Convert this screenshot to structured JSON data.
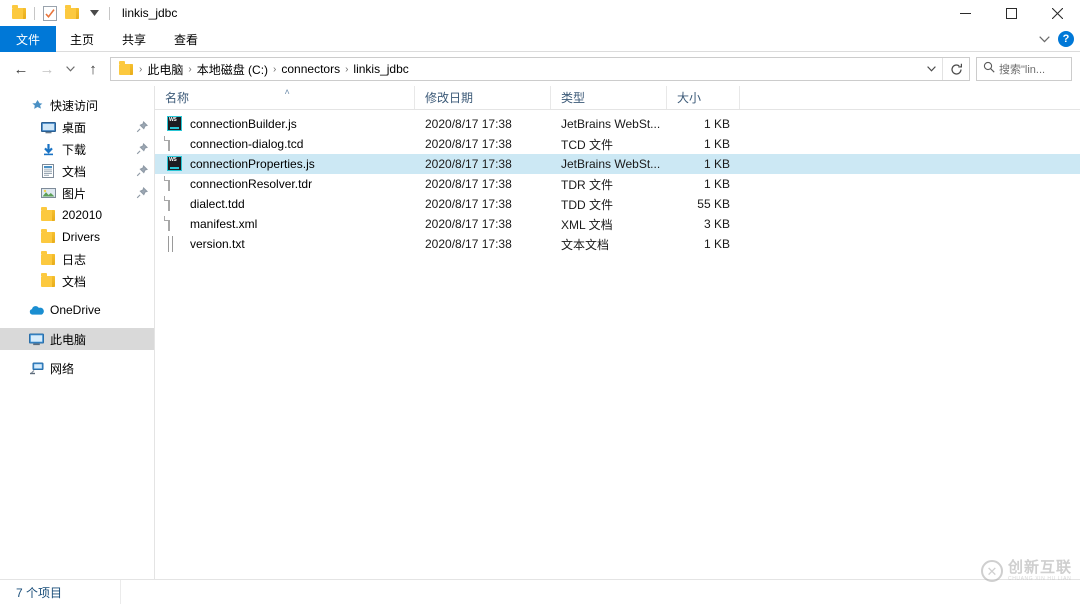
{
  "window": {
    "title": "linkis_jdbc",
    "quick_access": [
      {
        "name": "folder-icon",
        "label": "文件夹"
      },
      {
        "name": "properties-icon",
        "label": "属性"
      },
      {
        "name": "new-folder-icon",
        "label": "新建文件夹"
      },
      {
        "name": "customize-chevron-icon",
        "label": "自定义快速访问工具栏"
      }
    ],
    "controls": {
      "minimize": "─",
      "maximize": "□",
      "close": "✕",
      "ribbon_collapse": "⌄",
      "help": "?"
    }
  },
  "ribbon": {
    "tabs": [
      {
        "label": "文件",
        "active": true
      },
      {
        "label": "主页",
        "active": false
      },
      {
        "label": "共享",
        "active": false
      },
      {
        "label": "查看",
        "active": false
      }
    ]
  },
  "addressbar": {
    "back": "←",
    "forward": "→",
    "recent": "⌄",
    "up": "↑",
    "breadcrumbs": [
      "此电脑",
      "本地磁盘 (C:)",
      "connectors",
      "linkis_jdbc"
    ],
    "separator": "›",
    "dropdown": "⌄",
    "refresh": "↻",
    "search_placeholder": "搜索\"lin..."
  },
  "sidebar": {
    "groups": [
      {
        "header": {
          "label": "快速访问",
          "icon": "star-pin-icon"
        },
        "items": [
          {
            "label": "桌面",
            "icon": "desktop-icon",
            "pinned": true
          },
          {
            "label": "下载",
            "icon": "downloads-icon",
            "pinned": true
          },
          {
            "label": "文档",
            "icon": "documents-icon",
            "pinned": true
          },
          {
            "label": "图片",
            "icon": "pictures-icon",
            "pinned": true
          },
          {
            "label": "202010",
            "icon": "folder-icon",
            "pinned": false
          },
          {
            "label": "Drivers",
            "icon": "folder-icon",
            "pinned": false
          },
          {
            "label": "日志",
            "icon": "folder-icon",
            "pinned": false
          },
          {
            "label": "文档",
            "icon": "folder-icon",
            "pinned": false
          }
        ]
      },
      {
        "header": null,
        "items": [
          {
            "label": "OneDrive",
            "icon": "onedrive-cloud-icon",
            "pinned": false
          }
        ]
      },
      {
        "header": null,
        "items": [
          {
            "label": "此电脑",
            "icon": "this-pc-icon",
            "pinned": false,
            "selected": true
          }
        ]
      },
      {
        "header": null,
        "items": [
          {
            "label": "网络",
            "icon": "network-icon",
            "pinned": false
          }
        ]
      }
    ]
  },
  "filelist": {
    "columns": [
      {
        "label": "名称",
        "sorted": "asc",
        "sort_glyph": "˄"
      },
      {
        "label": "修改日期",
        "sorted": null,
        "sort_glyph": ""
      },
      {
        "label": "类型",
        "sorted": null,
        "sort_glyph": ""
      },
      {
        "label": "大小",
        "sorted": null,
        "sort_glyph": ""
      }
    ],
    "rows": [
      {
        "name": "connectionBuilder.js",
        "date": "2020/8/17 17:38",
        "type": "JetBrains WebSt...",
        "size": "1 KB",
        "icon": "webstorm-file-icon",
        "selected": false
      },
      {
        "name": "connection-dialog.tcd",
        "date": "2020/8/17 17:38",
        "type": "TCD 文件",
        "size": "1 KB",
        "icon": "blank-document-icon",
        "selected": false
      },
      {
        "name": "connectionProperties.js",
        "date": "2020/8/17 17:38",
        "type": "JetBrains WebSt...",
        "size": "1 KB",
        "icon": "webstorm-file-icon",
        "selected": true
      },
      {
        "name": "connectionResolver.tdr",
        "date": "2020/8/17 17:38",
        "type": "TDR 文件",
        "size": "1 KB",
        "icon": "blank-document-icon",
        "selected": false
      },
      {
        "name": "dialect.tdd",
        "date": "2020/8/17 17:38",
        "type": "TDD 文件",
        "size": "55 KB",
        "icon": "blank-document-icon",
        "selected": false
      },
      {
        "name": "manifest.xml",
        "date": "2020/8/17 17:38",
        "type": "XML 文档",
        "size": "3 KB",
        "icon": "blank-document-icon",
        "selected": false
      },
      {
        "name": "version.txt",
        "date": "2020/8/17 17:38",
        "type": "文本文档",
        "size": "1 KB",
        "icon": "text-document-icon",
        "selected": false
      }
    ]
  },
  "statusbar": {
    "item_count": "7 个项目"
  },
  "watermark": {
    "logo_glyph": "✕",
    "main": "创新互联",
    "sub": "CHUANG XIN HU LIAN"
  },
  "colors": {
    "accent": "#0078d7",
    "selection": "#cce8f4",
    "nav_selection": "#d9d9d9",
    "folder": "#fcc93f",
    "header_text": "#3c5a78",
    "status_text": "#1a4e7a"
  }
}
